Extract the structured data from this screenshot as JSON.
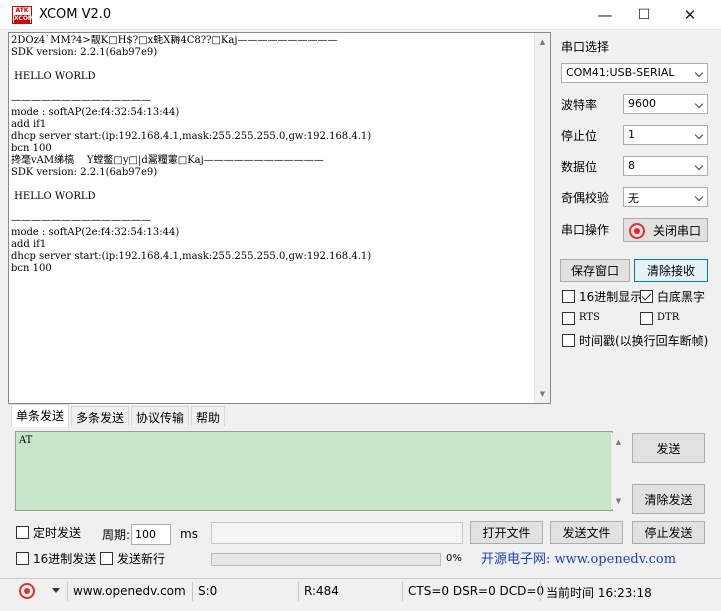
{
  "window": {
    "logo_top": "ATK",
    "logo_bottom": "XCOM",
    "title": "XCOM V2.0",
    "minimize": "—",
    "maximize": "☐",
    "close": "✕"
  },
  "receive": {
    "text": "2DOz4`MM?4>靓K□H$?□x蚝X耨4C8??□Kaj——————————\nSDK version: 2.2.1(6ab97e9)\n\n HELLO WORLD\n\n——————————————\nmode : softAP(2e:f4:32:54:13:44)\nadd if1\ndhcp server start:(ip:192.168.4.1,mask:255.255.255.0,gw:192.168.4.1)\nbcn 100\n搀毫vAM绨槁    Y螳鳖□y□|d翯糧藼□Kaj————————————\nSDK version: 2.2.1(6ab97e9)\n\n HELLO WORLD\n\n——————————————\nmode : softAP(2e:f4:32:54:13:44)\nadd if1\ndhcp server start:(ip:192.168.4.1,mask:255.255.255.0,gw:192.168.4.1)\nbcn 100"
  },
  "settings": {
    "port_label": "串口选择",
    "port_value": "COM41:USB-SERIAL",
    "baud_label": "波特率",
    "baud_value": "9600",
    "stop_label": "停止位",
    "stop_value": "1",
    "data_label": "数据位",
    "data_value": "8",
    "parity_label": "奇偶校验",
    "parity_value": "无",
    "op_label": "串口操作",
    "op_button": "关闭串口",
    "save_button": "保存窗口",
    "clear_button": "清除接收",
    "hex_display": "16进制显示",
    "white_bg": "白底黑字",
    "rts": "RTS",
    "dtr": "DTR",
    "timestamp": "时间戳(以换行回车断帧)"
  },
  "tabs": [
    "单条发送",
    "多条发送",
    "协议传输",
    "帮助"
  ],
  "send": {
    "text": "AT",
    "send_button": "发送",
    "clear_send_button": "清除发送",
    "timed_send": "定时发送",
    "period_label": "周期:",
    "period_value": "100",
    "period_unit": "ms",
    "open_file": "打开文件",
    "send_file": "发送文件",
    "stop_send": "停止发送",
    "hex_send": "16进制发送",
    "send_newline": "发送新行",
    "progress_text": "0%",
    "progress": 0,
    "link_text": "开源电子网: www.openedv.com"
  },
  "status": {
    "site": "www.openedv.com",
    "sent": "S:0",
    "received": "R:484",
    "lines": "CTS=0 DSR=0 DCD=0",
    "time": "当前时间 16:23:18"
  },
  "colors": {
    "send_area": "#c7e6c7",
    "link": "#1f3fbf",
    "focus_border": "#0078d7",
    "status_led": "#dd3333"
  }
}
